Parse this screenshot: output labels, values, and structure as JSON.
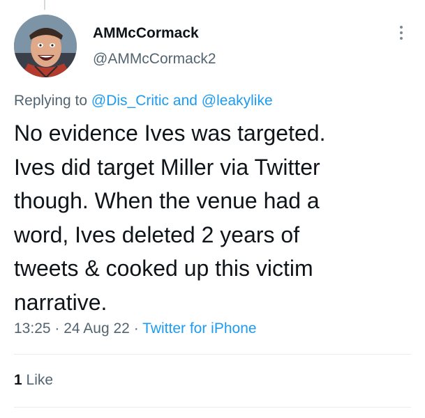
{
  "tweet": {
    "author": {
      "display_name": "AMMcCormack",
      "handle": "@AMMcCormack2"
    },
    "reply": {
      "prefix": "Replying to",
      "mentions": [
        "@Dis_Critic",
        "@leakylike"
      ],
      "conjunction": "and"
    },
    "text_lines": [
      "No evidence Ives was targeted.",
      "Ives did target Miller via Twitter",
      "though. When the venue had a",
      "word, Ives deleted 2 years of",
      "tweets & cooked up this victim",
      "narrative."
    ],
    "time": "13:25",
    "date": "24 Aug 22",
    "separator": "·",
    "source": "Twitter for iPhone",
    "likes": {
      "count": "1",
      "label": "Like"
    }
  },
  "icons": {
    "more": "more-options-icon",
    "avatar": "user-avatar"
  },
  "colors": {
    "text": "#0f1419",
    "secondary": "#536471",
    "link": "#1d9bf0",
    "divider": "#e6ecf0"
  }
}
